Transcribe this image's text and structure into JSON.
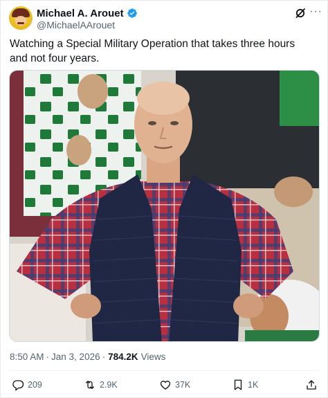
{
  "author": {
    "display_name": "Michael A. Arouet",
    "handle": "@MichaelAArouet"
  },
  "tweet": {
    "text": "Watching a Special Military Operation that takes three hours and not four years."
  },
  "meta": {
    "time": "8:50 AM",
    "separator": "·",
    "date": "Jan 3, 2026",
    "views_count": "784.2K",
    "views_label": "Views"
  },
  "actions": {
    "replies": "209",
    "reposts": "2.9K",
    "likes": "37K",
    "bookmarks": "1K"
  },
  "colors": {
    "verified": "#1d9bf0",
    "text_secondary": "#536471",
    "text_primary": "#0f1419"
  },
  "icons": [
    "verified-badge-icon",
    "grok-icon",
    "more-icon",
    "reply-icon",
    "retweet-icon",
    "like-icon",
    "bookmark-icon",
    "share-icon"
  ]
}
